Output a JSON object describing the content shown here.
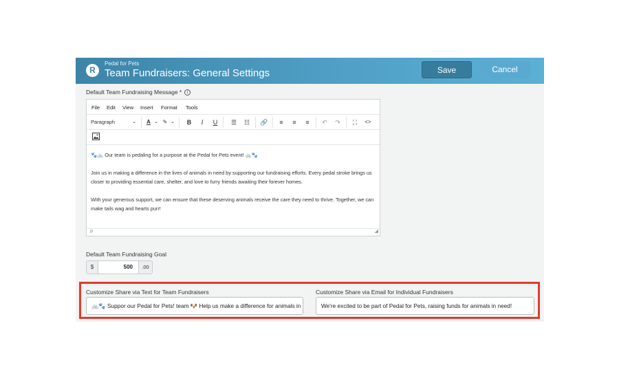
{
  "header": {
    "org_name": "Pedal for Pets",
    "logo_letter": "R",
    "title": "Team Fundraisers: General Settings",
    "save_label": "Save",
    "cancel_label": "Cancel"
  },
  "message_field": {
    "label": "Default Team Fundraising Message *",
    "info_icon": "i",
    "menu": [
      "File",
      "Edit",
      "View",
      "Insert",
      "Format",
      "Tools"
    ],
    "toolbar": {
      "format_select": "Paragraph",
      "bold": "B",
      "italic": "I",
      "underline": "U"
    },
    "content": [
      "🐾🚲 Our team is pedaling for a purpose at the Pedal for Pets event! 🚲🐾",
      "Join us in making a difference in the lives of animals in need by supporting our fundraising efforts. Every pedal stroke brings us closer to providing essential care, shelter, and love to furry friends awaiting their forever homes.",
      "With your generous support, we can ensure that these deserving animals receive the care they need to thrive. Together, we can make tails wag and hearts purr!"
    ],
    "status_path": "P"
  },
  "goal_field": {
    "label": "Default Team Fundraising Goal",
    "currency": "$",
    "value": "500",
    "cents": ".00"
  },
  "share_text": {
    "label": "Customize Share via Text for Team Fundraisers",
    "value": "🚲🐾 Suppor our Pedal for Pets! team 🐶 Help us make a difference for animals in need!"
  },
  "share_email": {
    "label": "Customize Share via Email for Individual Fundraisers",
    "value": "We're excited to be part of Pedal for Pets, raising funds for animals in need!"
  },
  "colors": {
    "header_gradient_start": "#3d84a8",
    "header_gradient_end": "#5bb0d6",
    "highlight_border": "#e03b2a"
  }
}
